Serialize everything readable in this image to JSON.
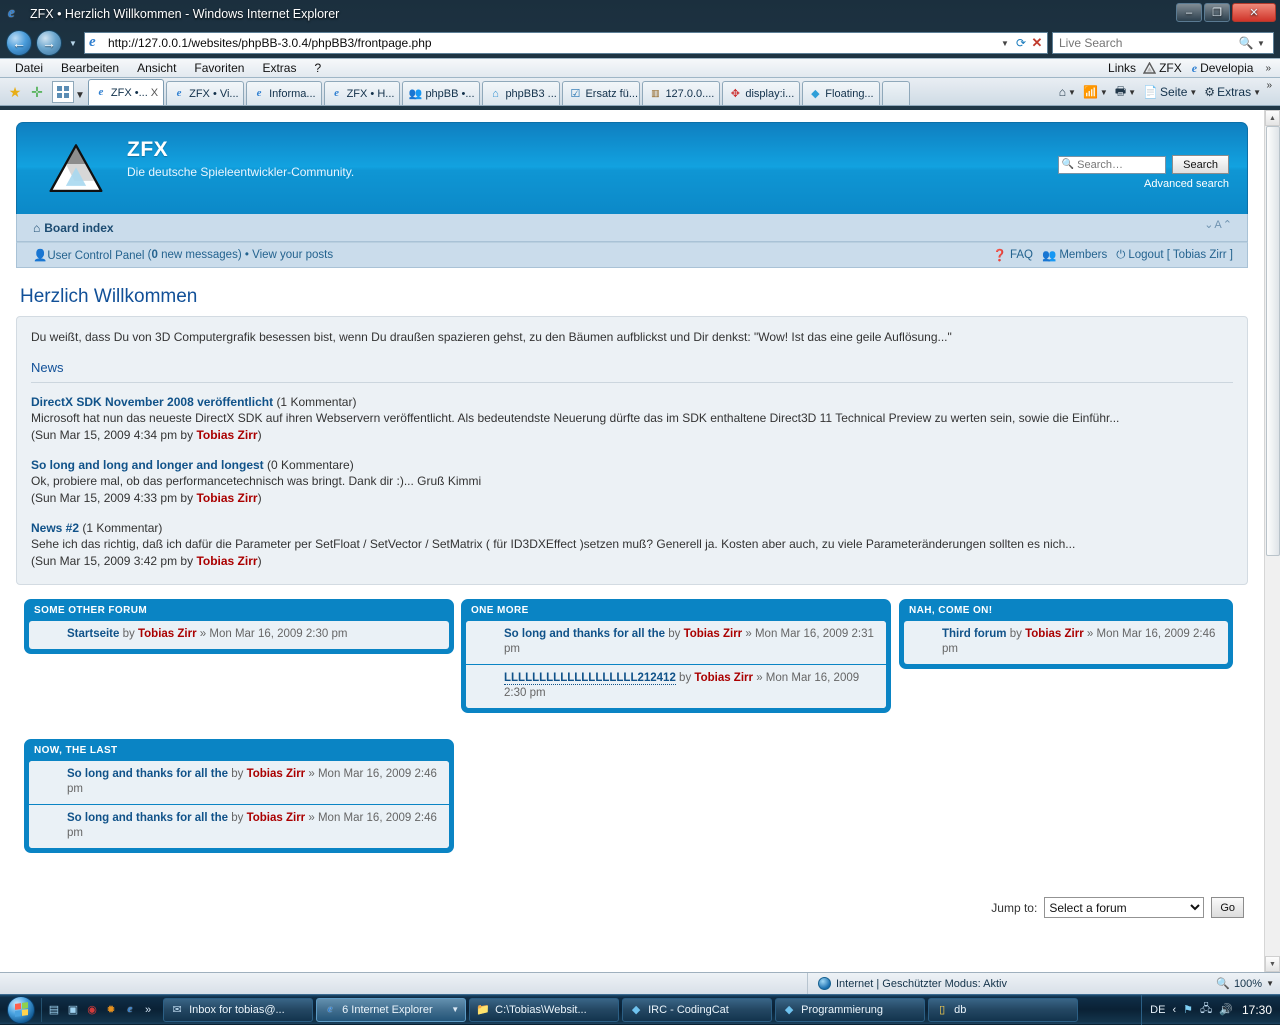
{
  "window": {
    "title": "ZFX • Herzlich Willkommen - Windows Internet Explorer",
    "minimize": "–",
    "maximize": "❐",
    "close": "✕"
  },
  "address_bar": {
    "url": "http://127.0.0.1/websites/phpBB-3.0.4/phpBB3/frontpage.php",
    "dropdown_icon": "chevron-down-icon",
    "refresh_icon": "refresh-icon",
    "stop_icon": "stop-icon",
    "live_search_placeholder": "Live Search",
    "back_icon": "back-arrow-icon",
    "forward_icon": "forward-arrow-icon"
  },
  "menu_bar": {
    "items": [
      "Datei",
      "Bearbeiten",
      "Ansicht",
      "Favoriten",
      "Extras",
      "?"
    ],
    "links_label": "Links",
    "link_items": [
      "ZFX",
      "Developia"
    ],
    "overflow": "»"
  },
  "tabs": [
    {
      "label": "ZFX •...",
      "active": true,
      "icon": "ie-icon"
    },
    {
      "label": "ZFX • Vi...",
      "active": false,
      "icon": "ie-icon"
    },
    {
      "label": "Informa...",
      "active": false,
      "icon": "ie-icon"
    },
    {
      "label": "ZFX • H...",
      "active": false,
      "icon": "ie-icon"
    },
    {
      "label": "phpBB •...",
      "active": false,
      "icon": "people-icon"
    },
    {
      "label": "phpBB3 ...",
      "active": false,
      "icon": "home-icon"
    },
    {
      "label": "Ersatz fü...",
      "active": false,
      "icon": "check-icon"
    },
    {
      "label": "127.0.0....",
      "active": false,
      "icon": "pma-icon"
    },
    {
      "label": "display:i...",
      "active": false,
      "icon": "google-icon"
    },
    {
      "label": "Floating...",
      "active": false,
      "icon": "diamond-icon"
    }
  ],
  "tab_close_label": "X",
  "toolbar": {
    "home_icon": "home-icon",
    "feeds_icon": "rss-icon",
    "print_icon": "printer-icon",
    "page_label": "Seite",
    "tools_label": "Extras",
    "overflow": "»"
  },
  "site": {
    "name": "ZFX",
    "description": "Die deutsche Spieleentwickler-Community.",
    "logo_icon": "penrose-triangle-logo"
  },
  "header_search": {
    "placeholder": "Search…",
    "button": "Search",
    "advanced": "Advanced search",
    "icon": "search-icon"
  },
  "navbar": {
    "board_index": "Board index",
    "home_icon": "house-icon",
    "font_size_control": "⌄A⌃",
    "ucp_label": "User Control Panel",
    "ucp_messages_count": "0",
    "ucp_messages_suffix": " new messages",
    "separator": "•",
    "view_posts": "View your posts",
    "faq": "FAQ",
    "members": "Members",
    "logout": "Logout [ Tobias Zirr ]"
  },
  "page": {
    "title": "Herzlich Willkommen",
    "intro": "Du weißt, dass Du von 3D Computergrafik besessen bist, wenn Du draußen spazieren gehst, zu den Bäumen aufblickst und Dir denkst: \"Wow! Ist das eine geile Auflösung...\"",
    "news_heading": "News"
  },
  "news": [
    {
      "title": "DirectX SDK November 2008 veröffentlicht",
      "comments": "(1 Kommentar)",
      "body": "Microsoft hat nun das neueste DirectX SDK auf ihren Webservern veröffentlicht. Als bedeutendste Neuerung dürfte das im SDK enthaltene Direct3D 11 Technical Preview zu werten sein, sowie die Einführ...",
      "meta_pre": "(Sun Mar 15, 2009 4:34 pm by ",
      "author": "Tobias Zirr",
      "meta_post": ")"
    },
    {
      "title": "So long and long and longer and longest",
      "comments": "(0 Kommentare)",
      "body": "Ok, probiere mal, ob das performancetechnisch was bringt. Dank dir :)... Gruß Kimmi",
      "meta_pre": "(Sun Mar 15, 2009 4:33 pm by ",
      "author": "Tobias Zirr",
      "meta_post": ")"
    },
    {
      "title": "News #2",
      "comments": "(1 Kommentar)",
      "body": "Sehe ich das richtig, daß ich dafür die Parameter per SetFloat / SetVector / SetMatrix ( für ID3DXEffect )setzen muß? Generell ja. Kosten aber auch, zu viele Parameteränderungen sollten es nich...",
      "meta_pre": "(Sun Mar 15, 2009 3:42 pm by ",
      "author": "Tobias Zirr",
      "meta_post": ")"
    }
  ],
  "forum_blocks": [
    {
      "heading": "SOME OTHER FORUM",
      "rows": [
        {
          "title": "Startseite",
          "dotted": false,
          "by": "by",
          "author": "Tobias Zirr",
          "sep": "»",
          "date": "Mon Mar 16, 2009 2:30 pm"
        }
      ]
    },
    {
      "heading": "ONE MORE",
      "rows": [
        {
          "title": "So long and thanks for all the",
          "dotted": false,
          "by": "by",
          "author": "Tobias Zirr",
          "sep": "»",
          "date": "Mon Mar 16, 2009 2:31 pm"
        },
        {
          "title": "LLLLLLLLLLLLLLLLLLL212412",
          "dotted": true,
          "by": "by",
          "author": "Tobias Zirr",
          "sep": "»",
          "date": "Mon Mar 16, 2009 2:30 pm"
        }
      ]
    },
    {
      "heading": "NAH, COME ON!",
      "rows": [
        {
          "title": "Third forum",
          "dotted": false,
          "by": "by",
          "author": "Tobias Zirr",
          "sep": "»",
          "date": "Mon Mar 16, 2009 2:46 pm"
        }
      ]
    },
    {
      "heading": "NOW, THE LAST",
      "rows": [
        {
          "title": "So long and thanks for all the",
          "dotted": false,
          "by": "by",
          "author": "Tobias Zirr",
          "sep": "»",
          "date": "Mon Mar 16, 2009 2:46 pm"
        },
        {
          "title": "So long and thanks for all the",
          "dotted": false,
          "by": "by",
          "author": "Tobias Zirr",
          "sep": "»",
          "date": "Mon Mar 16, 2009 2:46 pm"
        }
      ]
    }
  ],
  "jump_to": {
    "label": "Jump to:",
    "selected": "Select a forum",
    "go": "Go"
  },
  "status_bar": {
    "zone": "Internet | Geschützter Modus: Aktiv",
    "zoom": "100%",
    "zoom_icon": "magnifier-plus-icon"
  },
  "taskbar": {
    "start_icon": "windows-orb-icon",
    "quick_launch": [
      "show-desktop-icon",
      "switch-windows-icon",
      "opera-icon",
      "firefox-icon",
      "ie-icon"
    ],
    "quick_launch_overflow": "»",
    "tasks": [
      {
        "label": "Inbox for tobias@...",
        "icon": "mail-icon",
        "pressed": false
      },
      {
        "label": "6 Internet Explorer",
        "icon": "ie-icon",
        "pressed": true,
        "group": true
      },
      {
        "label": "C:\\Tobias\\Websit...",
        "icon": "folder-icon",
        "pressed": false
      },
      {
        "label": "IRC - CodingCat",
        "icon": "diamond-icon",
        "pressed": false
      },
      {
        "label": "Programmierung",
        "icon": "diamond-icon",
        "pressed": false
      },
      {
        "label": "db",
        "icon": "window-icon",
        "pressed": false
      }
    ],
    "tray_language": "DE",
    "tray_icons": [
      "chevron-left-icon",
      "flag-icon",
      "network-icon",
      "volume-icon"
    ],
    "clock": "17:30"
  },
  "colors": {
    "accent": "#0f96d4",
    "link": "#105289",
    "author": "#aa0000",
    "panel_bg": "#ecf1f5",
    "navbar_bg": "#cadceb"
  }
}
